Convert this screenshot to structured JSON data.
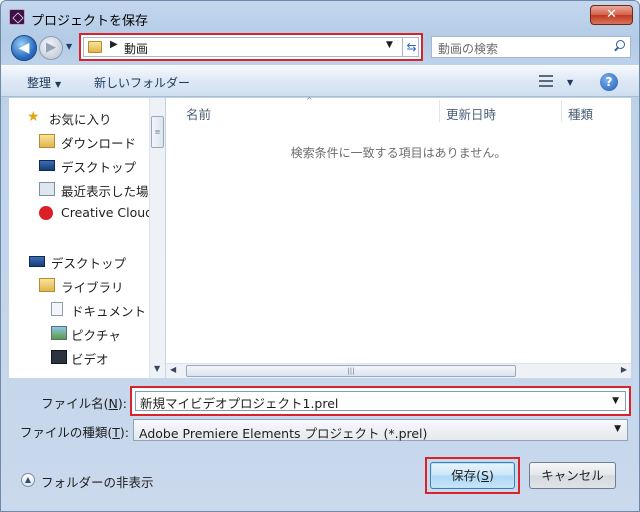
{
  "window": {
    "title": "プロジェクトを保存",
    "close_label": "✕"
  },
  "nav": {
    "back_label": "◀",
    "forward_label": "▶",
    "history_dropdown": "▼",
    "address_path": "動画",
    "address_sep": "▶",
    "address_dropdown": "▼",
    "refresh_label": "⇆",
    "search_placeholder": "動画の検索"
  },
  "toolbar": {
    "organize": "整理",
    "new_folder": "新しいフォルダー",
    "dropdown": "▼",
    "help": "?"
  },
  "sidebar": {
    "favorites": [
      {
        "label": "お気に入り",
        "icon": "star-icon"
      },
      {
        "label": "ダウンロード",
        "icon": "download-folder-icon"
      },
      {
        "label": "デスクトップ",
        "icon": "desktop-icon"
      },
      {
        "label": "最近表示した場所",
        "icon": "recent-places-icon"
      },
      {
        "label": "Creative Cloud",
        "icon": "creative-cloud-icon"
      }
    ],
    "tree": [
      {
        "label": "デスクトップ",
        "icon": "desktop-icon"
      },
      {
        "label": "ライブラリ",
        "icon": "library-icon"
      },
      {
        "label": "ドキュメント",
        "icon": "documents-icon"
      },
      {
        "label": "ピクチャ",
        "icon": "pictures-icon"
      },
      {
        "label": "ビデオ",
        "icon": "videos-icon"
      }
    ]
  },
  "content": {
    "columns": [
      "名前",
      "更新日時",
      "種類"
    ],
    "empty_message": "検索条件に一致する項目はありません。"
  },
  "form": {
    "filename_label": "ファイル名(",
    "filename_key": "N",
    "filename_label_end": "):",
    "filename_value": "新規マイビデオプロジェクト1.prel",
    "filetype_label": "ファイルの種類(",
    "filetype_key": "T",
    "filetype_label_end": "):",
    "filetype_value": "Adobe Premiere Elements プロジェクト (*.prel)"
  },
  "footer": {
    "hide_folders": "フォルダーの非表示",
    "save_label": "保存(",
    "save_key": "S",
    "save_label_end": ")",
    "cancel_label": "キャンセル"
  },
  "colors": {
    "highlight_red": "#d9232b",
    "accent_blue": "#2b6fc4"
  }
}
